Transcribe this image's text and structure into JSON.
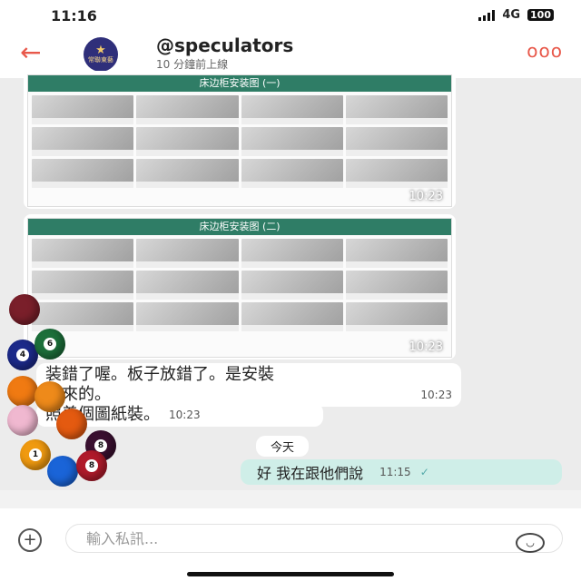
{
  "status": {
    "time": "11:16",
    "network": "4G",
    "battery": "100"
  },
  "header": {
    "back": "←",
    "name": "@speculators",
    "subtitle": "10 分鐘前上線",
    "more": "ooo",
    "avatar_mark": "★",
    "avatar_text": "常聯東藝"
  },
  "images": [
    {
      "title": "床边柜安装图 (一)",
      "time": "10:23"
    },
    {
      "title": "床边柜安装图 (二)",
      "time": "10:23"
    }
  ],
  "messages": {
    "msg1": {
      "text1": "装錯了喔。板子放錯了。是安裝",
      "text2": "起來的。",
      "time": "10:23"
    },
    "msg2": {
      "text": "照着個圖紙裝。",
      "time": "10:23"
    },
    "date_divider": "今天",
    "outgoing": {
      "text": "好 我在跟他們說",
      "time": "11:15",
      "check": "✓"
    }
  },
  "input": {
    "placeholder": "輸入私訊...",
    "plus": "+",
    "emoji": "◡"
  },
  "sticker_balls": [
    "",
    "4",
    "6",
    "",
    "",
    "",
    "",
    "8",
    "1",
    "",
    "8",
    ""
  ],
  "colors": {
    "accent": "#e8584a",
    "outgoing_bubble": "#cfeee8"
  }
}
